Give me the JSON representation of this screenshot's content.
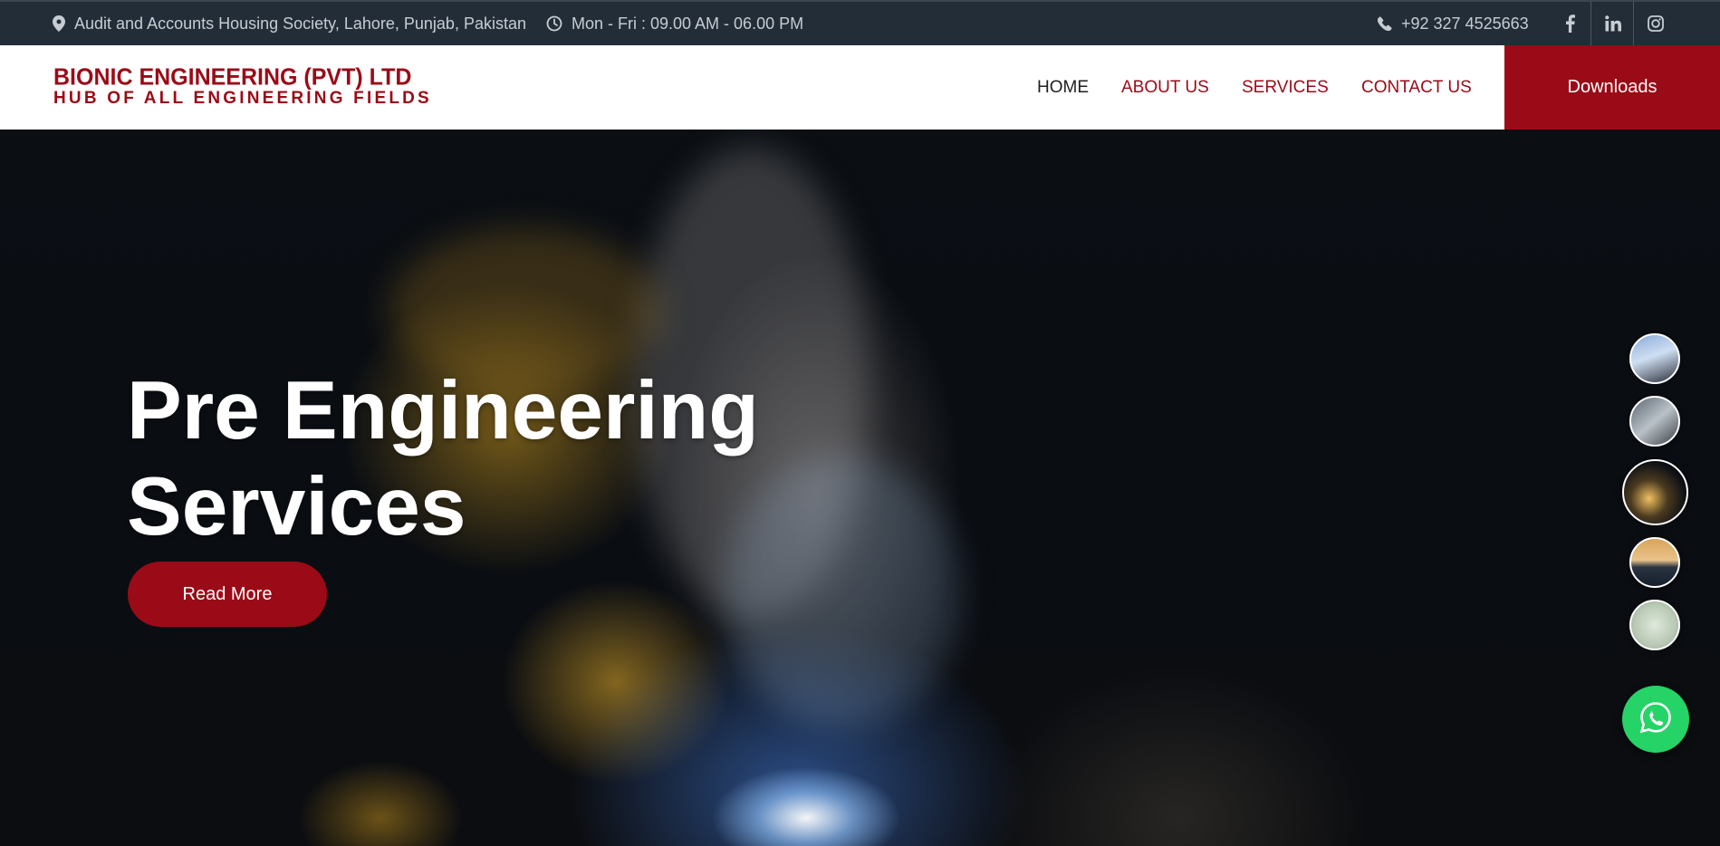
{
  "topbar": {
    "address": "Audit and Accounts Housing Society, Lahore, Punjab, Pakistan",
    "hours": "Mon - Fri : 09.00 AM - 06.00 PM",
    "phone": "+92 327 4525663",
    "icons": [
      "location-pin-icon",
      "clock-icon",
      "phone-icon",
      "facebook-icon",
      "linkedin-icon",
      "instagram-icon"
    ]
  },
  "header": {
    "logo_line1": "BIONIC ENGINEERING (PVT) LTD",
    "logo_line2": "HUB OF ALL ENGINEERING FIELDS",
    "nav": [
      {
        "label": "HOME",
        "active": true
      },
      {
        "label": "ABOUT US",
        "active": false
      },
      {
        "label": "SERVICES",
        "active": false
      },
      {
        "label": "CONTACT US",
        "active": false
      }
    ],
    "downloads_label": "Downloads"
  },
  "hero": {
    "title_line1": "Pre Engineering",
    "title_line2": "Services",
    "cta_label": "Read More"
  },
  "slider": {
    "slide_count": 5,
    "active_index": 2
  },
  "colors": {
    "brand": "#9b0a17",
    "topbar": "#222d38",
    "whatsapp": "#25d366"
  }
}
